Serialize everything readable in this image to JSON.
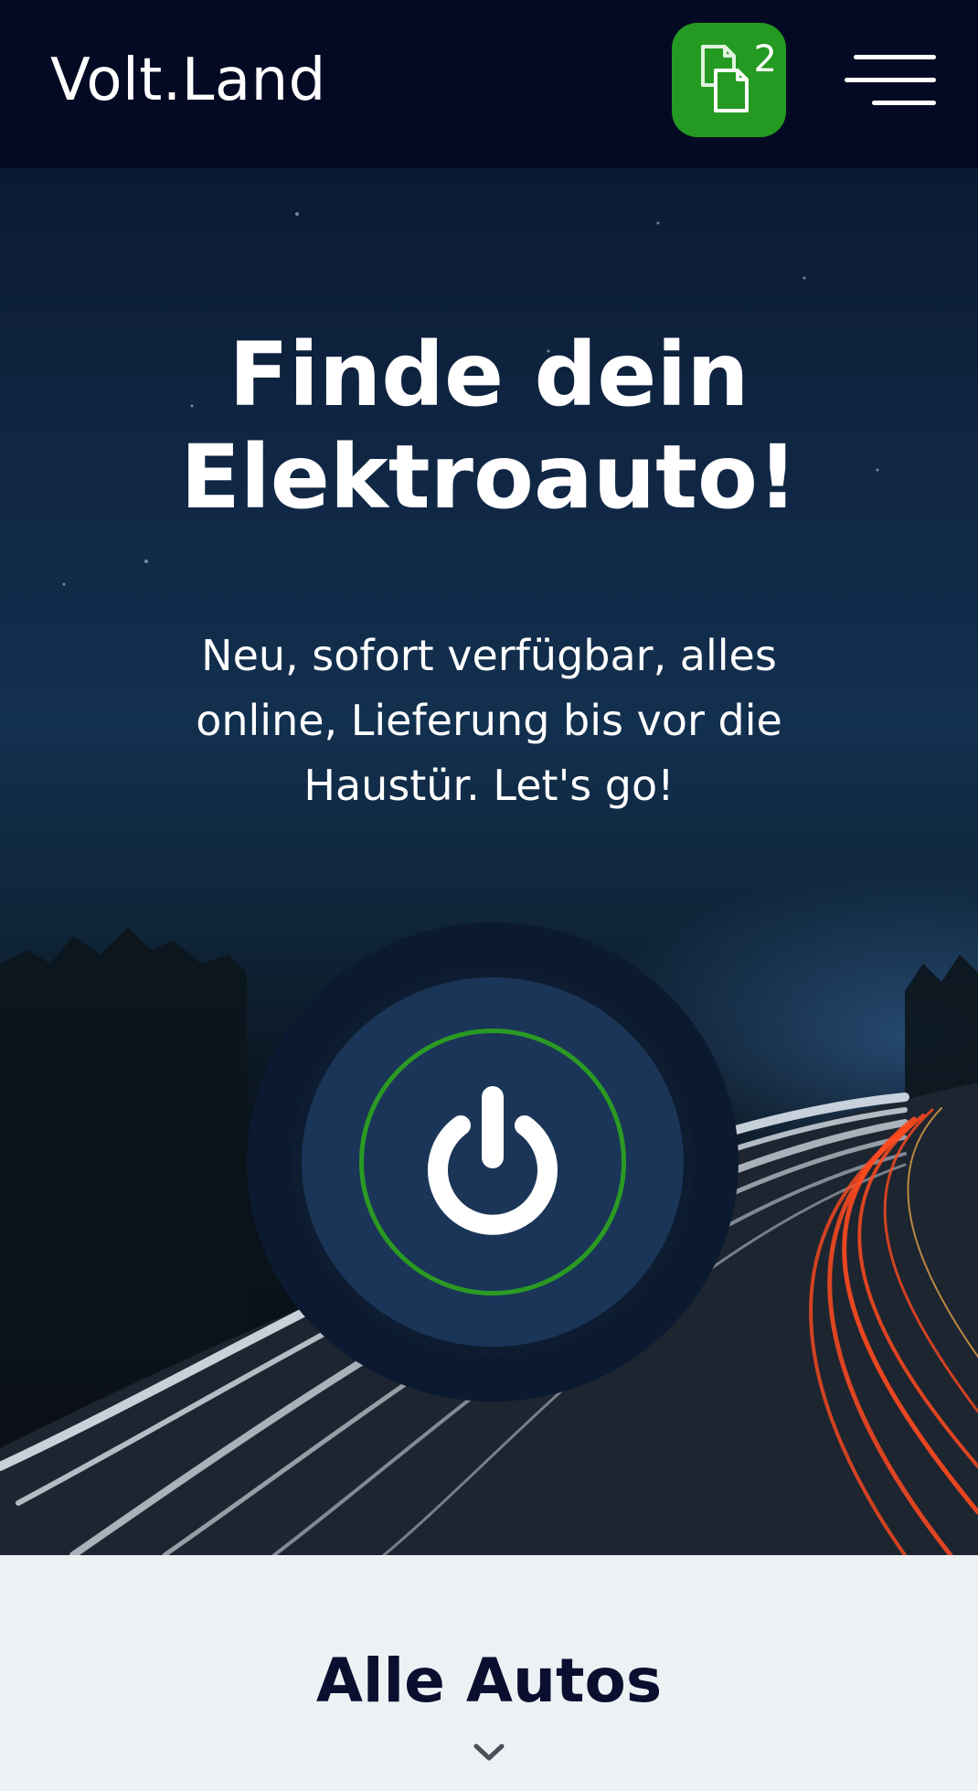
{
  "header": {
    "logo": "Volt.Land",
    "compare_count": "2",
    "compare_icon": "compare-documents-icon",
    "menu_icon": "hamburger-menu-icon"
  },
  "hero": {
    "title_line1": "Finde dein",
    "title_line2": "Elektroauto!",
    "subtitle_line1": "Neu, sofort verfügbar, alles",
    "subtitle_line2": "online, Lieferung bis vor die",
    "subtitle_line3": "Haustür. Let's go!",
    "power_icon": "power-icon"
  },
  "section": {
    "title": "Alle Autos",
    "chevron_icon": "chevron-down-icon"
  },
  "colors": {
    "header_bg": "#050a24",
    "accent_green": "#259a22",
    "section_bg": "#edf1f4",
    "title_navy": "#0a0f30"
  }
}
